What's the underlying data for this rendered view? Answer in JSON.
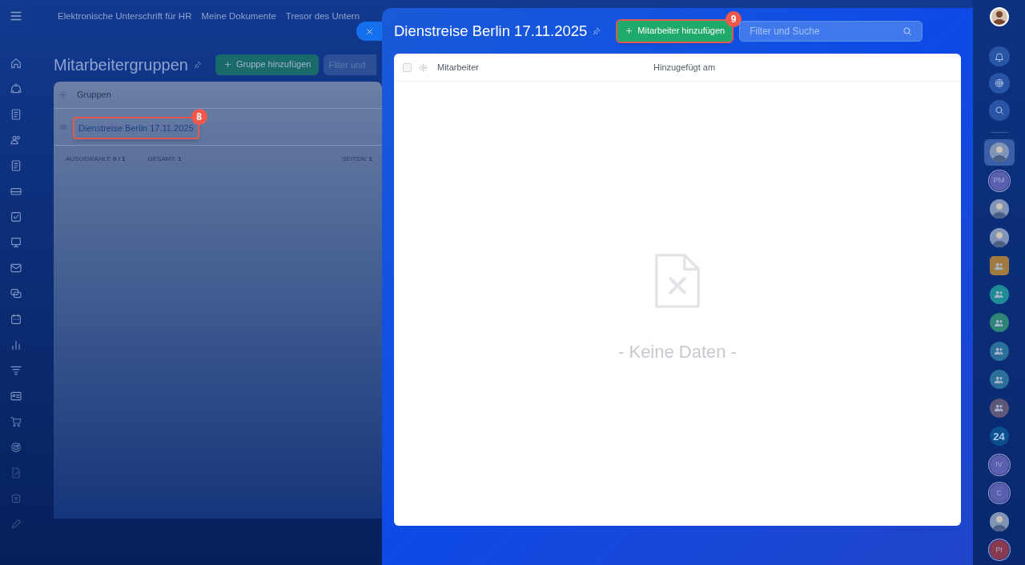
{
  "top_nav": {
    "items": [
      {
        "label": "Elektronische Unterschrift für HR"
      },
      {
        "label": "Meine Dokumente"
      },
      {
        "label": "Tresor des Untern"
      }
    ]
  },
  "page": {
    "title": "Mitarbeitergruppen",
    "add_button": "Gruppe hinzufügen",
    "filter": {
      "placeholder": "Filter und"
    },
    "grid": {
      "column": "Gruppen",
      "rows": [
        {
          "name": "Dienstreise Berlin 17.11.2025",
          "highlighted": true,
          "callout": "8"
        }
      ],
      "footer": [
        {
          "label": "AUSGEWÄHLT:",
          "value": "0 / 1"
        },
        {
          "label": "GESAMT:",
          "value": "1"
        },
        {
          "label": "SEITEN:",
          "value": "1"
        }
      ]
    }
  },
  "slider": {
    "title": "Dienstreise Berlin 17.11.2025",
    "add_button": {
      "label": "Mitarbeiter hinzufügen",
      "highlighted": true,
      "callout": "9"
    },
    "search": {
      "placeholder": "Filter und Suche"
    },
    "table": {
      "select_all_checked": false,
      "columns": [
        "Mitarbeiter",
        "Hinzugefügt am"
      ],
      "empty_text": "- Keine Daten -"
    }
  },
  "right_bar": {
    "chats": [
      {
        "kind": "photo",
        "selected": true
      },
      {
        "kind": "initials",
        "text": "PM",
        "color": "#5a5fae"
      },
      {
        "kind": "photo",
        "selected": false
      },
      {
        "kind": "photo",
        "selected": false
      },
      {
        "kind": "group",
        "color": "#a07a3e"
      },
      {
        "kind": "group",
        "color": "#1f8b96"
      },
      {
        "kind": "group",
        "color": "#2f8478"
      },
      {
        "kind": "group",
        "color": "#2c6f9a"
      },
      {
        "kind": "group",
        "color": "#2c6f9a"
      },
      {
        "kind": "group",
        "color": "#5d5878"
      },
      {
        "kind": "logo",
        "text": "24",
        "color": "#0b4f8f"
      },
      {
        "kind": "initials",
        "text": "IV",
        "color": "#5a5fae"
      },
      {
        "kind": "initials",
        "text": "C",
        "color": "#5a5fae"
      },
      {
        "kind": "photo",
        "selected": false
      },
      {
        "kind": "initials",
        "text": "PI",
        "color": "#8a3a4e"
      }
    ]
  }
}
